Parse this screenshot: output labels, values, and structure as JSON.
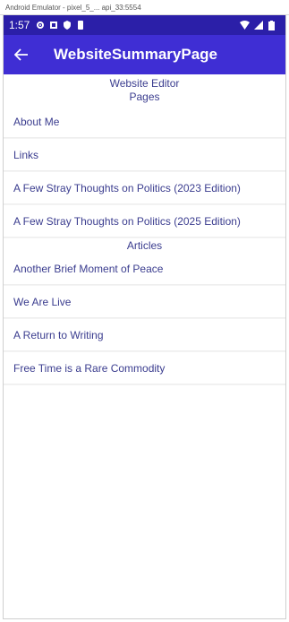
{
  "emulator": {
    "title": "Android Emulator - pixel_5_... api_33:5554"
  },
  "status_bar": {
    "time": "1:57"
  },
  "app_bar": {
    "title": "WebsiteSummaryPage",
    "back_icon": "arrow-back-icon"
  },
  "editor": {
    "heading": "Website Editor"
  },
  "pages": {
    "heading": "Pages",
    "items": [
      {
        "label": "About Me"
      },
      {
        "label": "Links"
      },
      {
        "label": "A Few Stray Thoughts on Politics (2023 Edition)"
      },
      {
        "label": "A Few Stray Thoughts on Politics (2025 Edition)"
      }
    ]
  },
  "articles": {
    "heading": "Articles",
    "items": [
      {
        "label": "Another Brief Moment of Peace"
      },
      {
        "label": "We Are Live"
      },
      {
        "label": "A Return to Writing"
      },
      {
        "label": "Free Time is a Rare Commodity"
      }
    ]
  },
  "colors": {
    "status_bar": "#2b1fa8",
    "app_bar": "#3f2ed4",
    "text": "#3b3d8f"
  }
}
